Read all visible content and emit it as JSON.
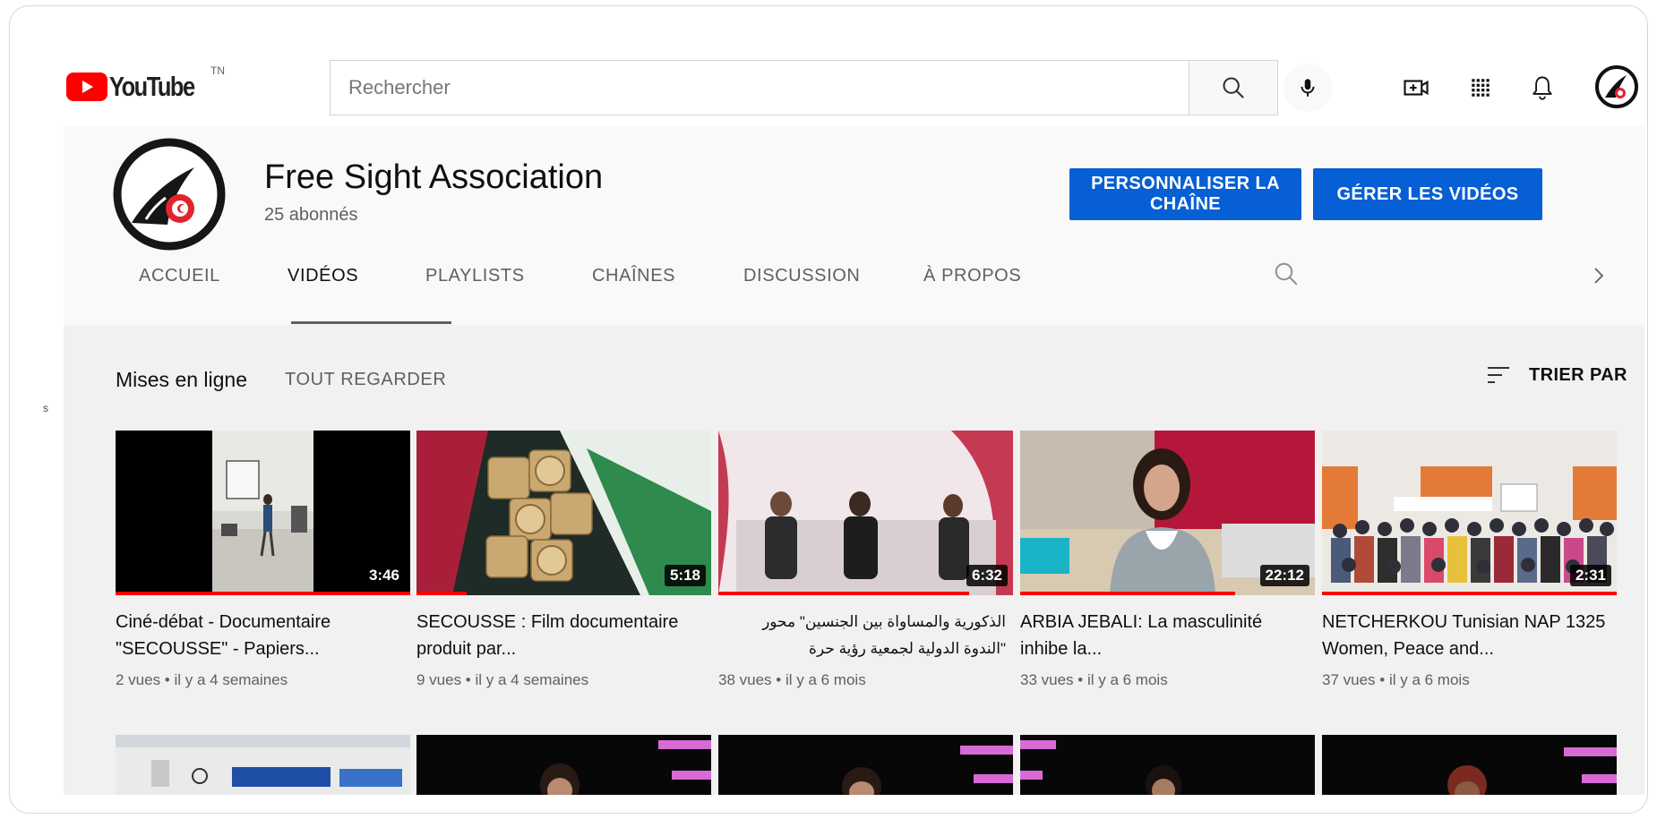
{
  "header": {
    "logo_text": "YouTube",
    "country_code": "TN",
    "search_placeholder": "Rechercher",
    "icons": [
      "search-icon",
      "mic-icon",
      "create-video-icon",
      "apps-grid-icon",
      "bell-icon",
      "account-avatar"
    ]
  },
  "channel": {
    "name": "Free Sight Association",
    "subscribers": "25 abonnés",
    "customize_label": "PERSONNALISER LA CHAÎNE",
    "manage_label": "GÉRER LES VIDÉOS"
  },
  "tabs": [
    {
      "label": "ACCUEIL",
      "active": false
    },
    {
      "label": "VIDÉOS",
      "active": true
    },
    {
      "label": "PLAYLISTS",
      "active": false
    },
    {
      "label": "CHAÎNES",
      "active": false
    },
    {
      "label": "DISCUSSION",
      "active": false
    },
    {
      "label": "À PROPOS",
      "active": false
    }
  ],
  "section": {
    "title": "Mises en ligne",
    "play_all": "TOUT REGARDER",
    "sort_label": "TRIER PAR"
  },
  "videos": [
    {
      "title": "Ciné-débat - Documentaire \"SECOUSSE\" - Papiers...",
      "meta": "2 vues • il y a 4 semaines",
      "duration": "3:46",
      "watched": 1.0
    },
    {
      "title": "SECOUSSE : Film documentaire produit par...",
      "meta": "9 vues • il y a 4 semaines",
      "duration": "5:18",
      "watched": 0.17
    },
    {
      "title": "الذكورية والمساواة بين الجنسين\" محور \"الندوة الدولية لجمعية رؤية حرة",
      "meta": "38 vues • il y a 6 mois",
      "duration": "6:32",
      "watched": 0.85
    },
    {
      "title": "ARBIA JEBALI: La masculinité inhibe la...",
      "meta": "33 vues • il y a 6 mois",
      "duration": "22:12",
      "watched": 0.73
    },
    {
      "title": "NETCHERKOU Tunisian NAP 1325 Women, Peace and...",
      "meta": "37 vues • il y a 6 mois",
      "duration": "2:31",
      "watched": 1.0
    }
  ],
  "stray_char": "s",
  "colors": {
    "accent_blue": "#065fd4",
    "brand_red": "#ff0000",
    "progress_red": "#ff0000"
  }
}
